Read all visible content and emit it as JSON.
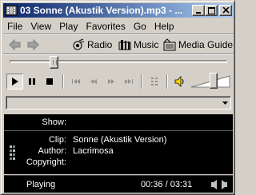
{
  "window": {
    "title": "03 Sonne (Akustik Version).mp3 - ..."
  },
  "menu": {
    "items": [
      "File",
      "View",
      "Play",
      "Favorites",
      "Go",
      "Help"
    ]
  },
  "nav": {
    "radio_label": "Radio",
    "music_label": "Music",
    "media_guide_label": "Media Guide"
  },
  "seek": {
    "position_fraction": 0.19
  },
  "volume": {
    "level_fraction": 0.6
  },
  "combo": {
    "value": ""
  },
  "info": {
    "show_label": "Show:",
    "show_value": "",
    "clip_label": "Clip:",
    "clip_value": "Sonne (Akustik Version)",
    "author_label": "Author:",
    "author_value": "Lacrimosa",
    "copyright_label": "Copyright:",
    "copyright_value": ""
  },
  "status": {
    "state": "Playing",
    "time": "00:36 / 03:31"
  },
  "colors": {
    "title_start": "#0a246a",
    "title_end": "#a6caf0",
    "panel_bg": "#000000",
    "face": "#d4d0c8"
  }
}
